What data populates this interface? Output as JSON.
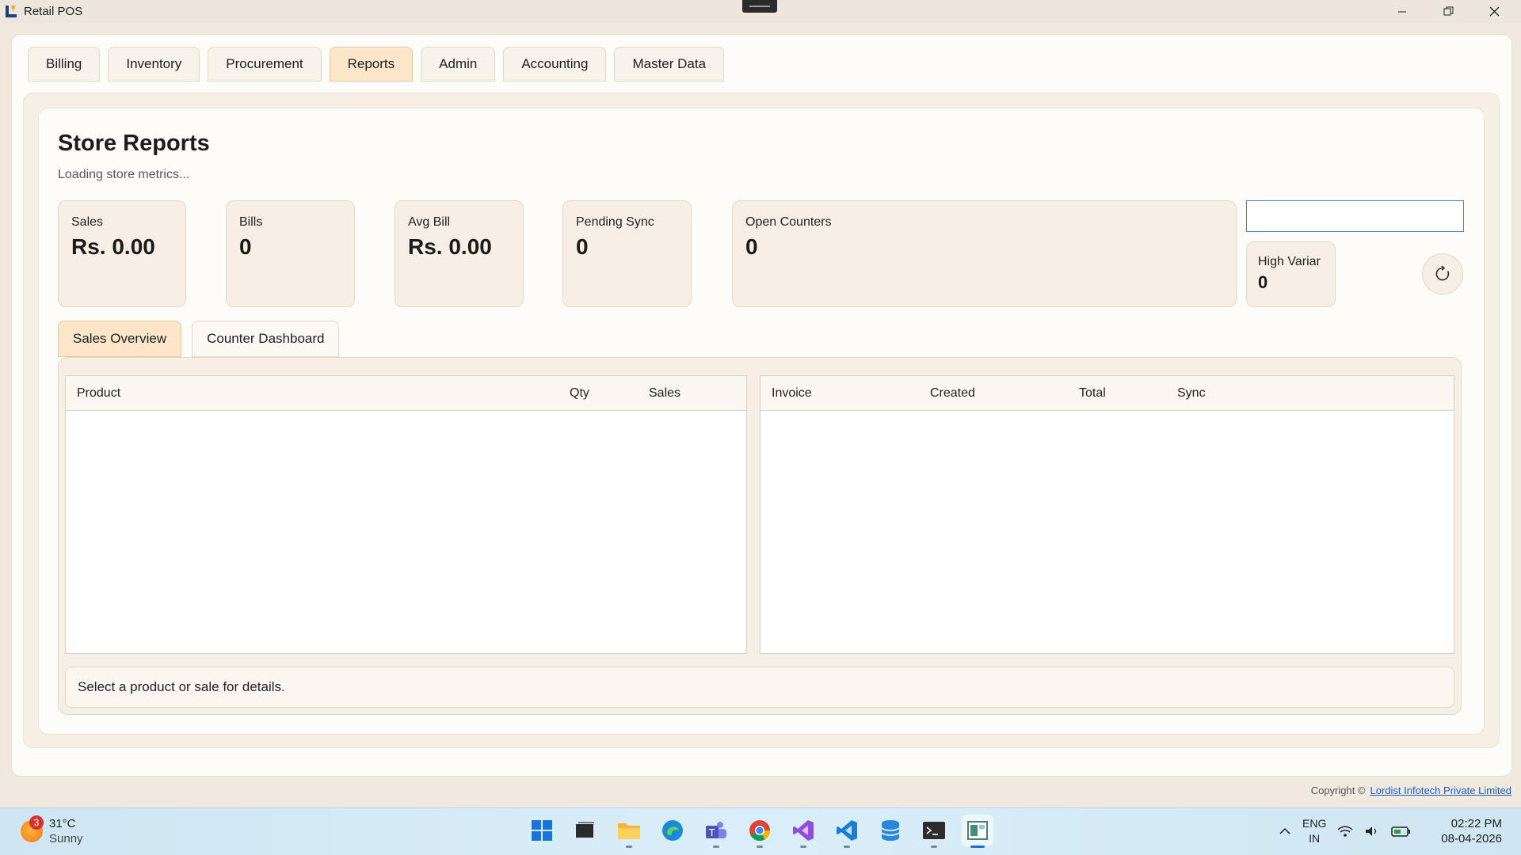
{
  "window": {
    "title": "Retail POS"
  },
  "main_tabs": [
    {
      "label": "Billing"
    },
    {
      "label": "Inventory"
    },
    {
      "label": "Procurement"
    },
    {
      "label": "Reports"
    },
    {
      "label": "Admin"
    },
    {
      "label": "Accounting"
    },
    {
      "label": "Master Data"
    }
  ],
  "active_tab": "Reports",
  "page": {
    "title": "Store Reports",
    "subtitle": "Loading store metrics..."
  },
  "metrics": {
    "sales": {
      "label": "Sales",
      "value": "Rs. 0.00"
    },
    "bills": {
      "label": "Bills",
      "value": "0"
    },
    "avg_bill": {
      "label": "Avg Bill",
      "value": "Rs. 0.00"
    },
    "pending_sync": {
      "label": "Pending Sync",
      "value": "0"
    },
    "open_counters": {
      "label": "Open Counters",
      "value": "0"
    },
    "high_variance": {
      "label": "High Variar",
      "value": "0"
    }
  },
  "filter": {
    "value": "",
    "placeholder": ""
  },
  "sub_tabs": [
    {
      "label": "Sales Overview"
    },
    {
      "label": "Counter Dashboard"
    }
  ],
  "product_table": {
    "columns": [
      "Product",
      "Qty",
      "Sales"
    ],
    "rows": []
  },
  "invoice_table": {
    "columns": [
      "Invoice",
      "Created",
      "Total",
      "Sync"
    ],
    "rows": []
  },
  "details": {
    "text": "Select a product or sale for details."
  },
  "footer": {
    "copyright_label": "Copyright ©",
    "company": "Lordist Infotech Private Limited"
  },
  "taskbar": {
    "weather": {
      "temp": "31°C",
      "condition": "Sunny",
      "badge": "3"
    },
    "lang": {
      "line1": "ENG",
      "line2": "IN"
    },
    "time": "02:22 PM",
    "date": "08-04-2026"
  },
  "colors": {
    "accent_tab": "#fbe6c9",
    "panel": "#f6efe6",
    "focus_border": "#4f7ed6",
    "link": "#1f5fbf"
  }
}
